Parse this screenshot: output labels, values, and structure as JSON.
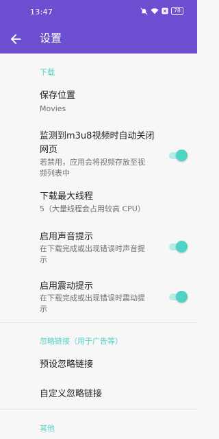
{
  "status_bar": {
    "time": "13:47",
    "battery": "78"
  },
  "appbar": {
    "title": "设置"
  },
  "sections": {
    "download": {
      "header": "下载",
      "save_location": {
        "title": "保存位置",
        "subtitle": "Movies"
      },
      "auto_close": {
        "title_line1": "监测到m3u8视频时自动关闭",
        "title_line2": "网页",
        "subtitle_line1": "若禁用，应用会将视频存放至视",
        "subtitle_line2": "频列表中",
        "enabled": true
      },
      "max_threads": {
        "title": "下载最大线程",
        "subtitle": "5（大量线程会占用较高 CPU）"
      },
      "sound_alert": {
        "title": "启用声音提示",
        "subtitle_line1": "在下载完成或出现错误时声音提",
        "subtitle_line2": "示",
        "enabled": true
      },
      "vibration_alert": {
        "title": "启用震动提示",
        "subtitle_line1": "在下载完成或出现错误时震动提",
        "subtitle_line2": "示",
        "enabled": true
      }
    },
    "ignore_links": {
      "header": "忽略链接（用于广告等）",
      "preset": {
        "title": "预设忽略链接"
      },
      "custom": {
        "title": "自定义忽略链接"
      }
    },
    "other": {
      "header": "其他"
    }
  },
  "colors": {
    "primary": "#6c4fd0",
    "accent": "#4fd3c4",
    "background": "#f7f7f7"
  }
}
